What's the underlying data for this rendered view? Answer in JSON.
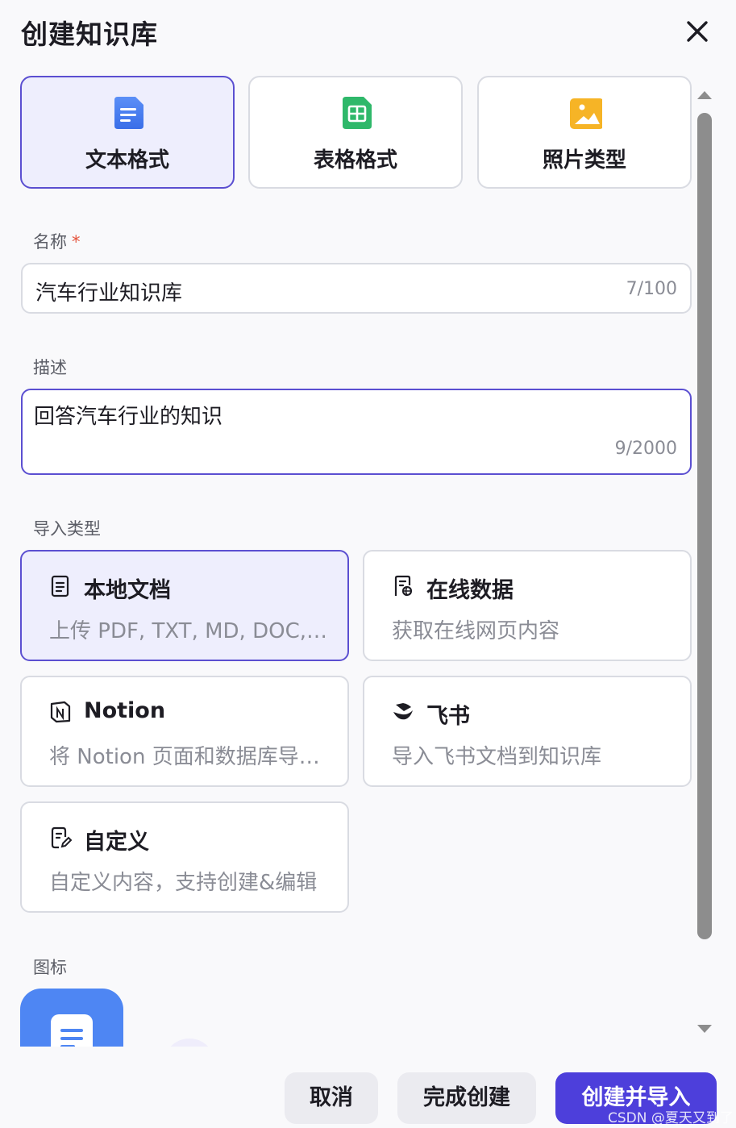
{
  "dialog": {
    "title": "创建知识库"
  },
  "format_tabs": [
    {
      "label": "文本格式",
      "icon": "text-doc-icon",
      "active": true
    },
    {
      "label": "表格格式",
      "icon": "table-icon",
      "active": false
    },
    {
      "label": "照片类型",
      "icon": "image-icon",
      "active": false
    }
  ],
  "name_field": {
    "label": "名称",
    "required_mark": "*",
    "value": "汽车行业知识库",
    "counter": "7/100"
  },
  "desc_field": {
    "label": "描述",
    "value": "回答汽车行业的知识",
    "counter": "9/2000"
  },
  "import_section": {
    "label": "导入类型",
    "options": [
      {
        "title": "本地文档",
        "desc": "上传 PDF, TXT, MD, DOC, …",
        "icon": "local-doc-icon",
        "active": true
      },
      {
        "title": "在线数据",
        "desc": "获取在线网页内容",
        "icon": "online-data-icon",
        "active": false
      },
      {
        "title": "Notion",
        "desc": "将 Notion 页面和数据库导…",
        "icon": "notion-icon",
        "active": false
      },
      {
        "title": "飞书",
        "desc": "导入飞书文档到知识库",
        "icon": "feishu-icon",
        "active": false
      },
      {
        "title": "自定义",
        "desc": "自定义内容，支持创建&编辑",
        "icon": "custom-edit-icon",
        "active": false
      }
    ]
  },
  "icon_section": {
    "label": "图标"
  },
  "footer": {
    "cancel_label": "取消",
    "finish_label": "完成创建",
    "create_import_label": "创建并导入"
  },
  "watermark": "CSDN @夏天又到了",
  "colors": {
    "accent": "#4d3fdb",
    "active_bg": "#eeeefd",
    "active_border": "#5b4fd1",
    "required": "#e5533c",
    "icon_blue": "#4e86f3"
  }
}
